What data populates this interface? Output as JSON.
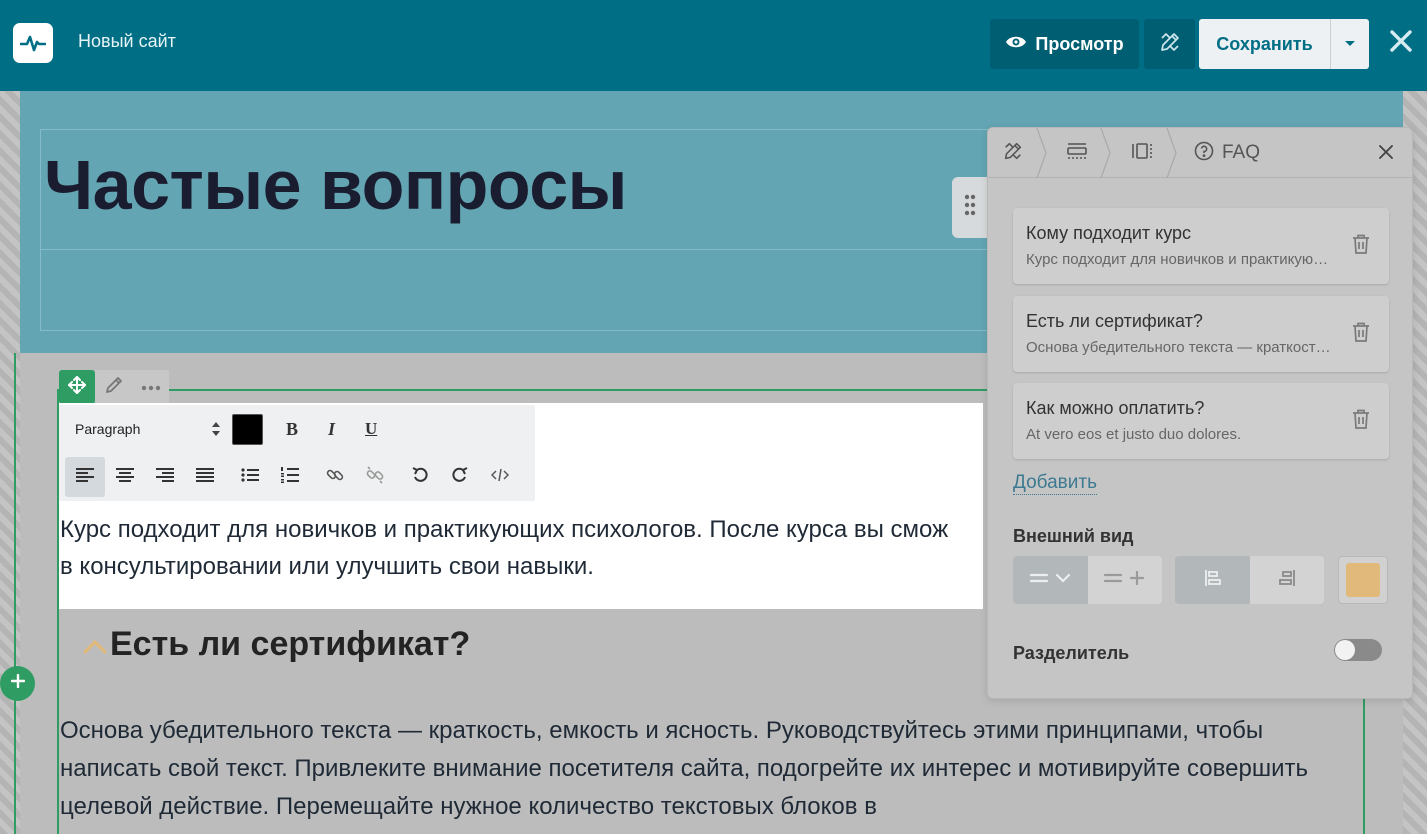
{
  "app": {
    "site_name": "Новый сайт",
    "preview_label": "Просмотр",
    "save_label": "Сохранить"
  },
  "editor": {
    "page_title": "Частые вопросы",
    "toolbar": {
      "format": "Paragraph",
      "bold": "B",
      "italic": "I",
      "underline": "U",
      "text_color": "#000000"
    },
    "answer_1_line1": "Курс подходит для новичков и практикующих психологов. После курса вы смож",
    "answer_1_line2": "в консультировании или улучшить свои навыки.",
    "question_2": "Есть ли сертификат?",
    "answer_2": "Основа убедительного текста — краткость, емкость и ясность. Руководствуйтесь этими принципами, чтобы написать свой текст. Привлеките внимание посетителя сайта, подогрейте их интерес и мотивируйте совершить целевой действие. Перемещайте нужное количество текстовых блоков в"
  },
  "panel": {
    "breadcrumb_label": "FAQ",
    "items": [
      {
        "question": "Кому подходит курс",
        "answer": "Курс подходит для новичков и практикующих психологов."
      },
      {
        "question": "Есть ли сертификат?",
        "answer": "Основа убедительного текста — краткость, емкость и ясность."
      },
      {
        "question": "Как можно оплатить?",
        "answer": "At vero eos et justo duo dolores."
      }
    ],
    "add_label": "Добавить",
    "appearance_label": "Внешний вид",
    "divider_label": "Разделитель",
    "divider_enabled": false,
    "accent_swatch_color": "#e1b97a"
  },
  "colors": {
    "topbar": "#006f86",
    "accent_green": "#2f9d63",
    "hero": "#64a5b3"
  }
}
